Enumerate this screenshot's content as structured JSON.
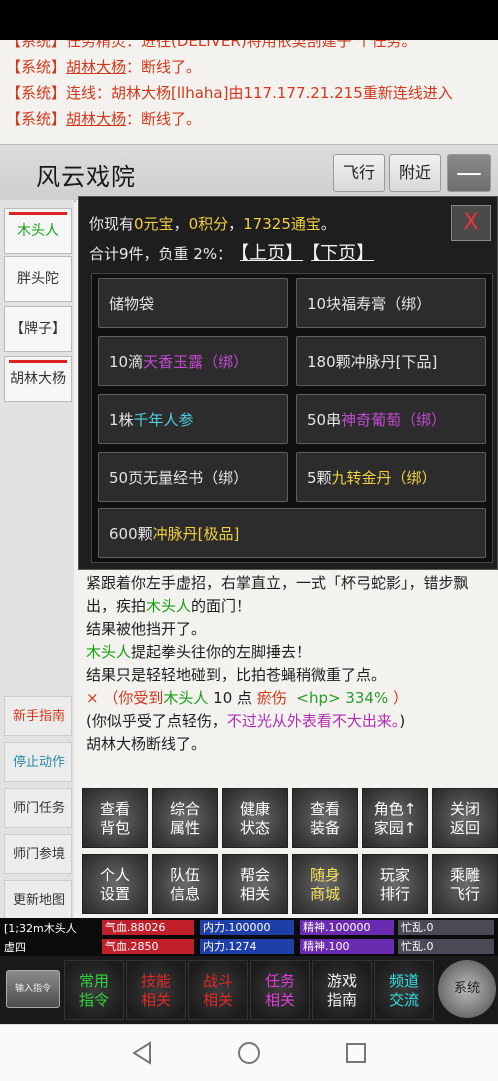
{
  "log": {
    "partial_line": "【系统】任务精灵：进往(DELIVER)将用依契剖建子    个任务。",
    "lines": [
      {
        "tag": "【系统】",
        "name": "胡林大杨",
        "text": "：断线了。",
        "underline": true
      },
      {
        "tag": "【系统】",
        "name": "",
        "text": "连线：胡林大杨[llhaha]由117.177.21.215重新连线进入",
        "underline": false
      },
      {
        "tag": "【系统】",
        "name": "胡林大杨",
        "text": "：断线了。",
        "underline": true
      }
    ]
  },
  "header": {
    "title": "风云戏院",
    "fly_label": "飞行",
    "nearby_label": "附近",
    "minimize_label": "—"
  },
  "npcs": [
    "木头人",
    "胖头陀",
    "【牌子】",
    "胡林大杨"
  ],
  "left_buttons": [
    "新手指南",
    "停止动作",
    "师门任务",
    "师门参境",
    "更新地图"
  ],
  "inventory": {
    "summary_prefix": "你现有",
    "yuanbao": "0元宝",
    "sep1": "，",
    "score": "0积分",
    "sep2": "，",
    "tongbao": "17325通宝",
    "summary_suffix": "。",
    "count_text": "合计9件，负重 2%：",
    "prev_page": "【上页】",
    "next_page": "【下页】",
    "close_label": "X",
    "items": [
      {
        "a": "储物袋",
        "b": "",
        "c": ""
      },
      {
        "a": "10块福寿膏（绑）",
        "b": "",
        "c": ""
      },
      {
        "a": "10滴",
        "b": "天香玉露（绑）",
        "c": "",
        "color": "p"
      },
      {
        "a": "180颗冲脉丹[下品]",
        "b": "",
        "c": ""
      },
      {
        "a": "1株",
        "b": "千年人参",
        "c": "",
        "color": "c"
      },
      {
        "a": "50串",
        "b": "神奇葡萄（绑）",
        "c": "",
        "color": "p"
      },
      {
        "a": "50页无量经书（绑）",
        "b": "",
        "c": ""
      },
      {
        "a": "5颗",
        "b": "九转金丹（绑）",
        "c": "",
        "color": "yl"
      },
      {
        "a": "600颗",
        "b": "冲脉丹[极品]",
        "c": "",
        "color": "yl"
      }
    ]
  },
  "story": {
    "l1": "紧跟着你左手虚招，右掌直立，一式「杯弓蛇影」，错步飘出，疾拍",
    "l1_name": "木头人",
    "l1_end": "的面门！",
    "l2": "结果被他挡开了。",
    "l3_name": "木头人",
    "l3": "提起拳头往你的左脚捶去！",
    "l4": "结果只是轻轻地碰到，比拍苍蝇稍微重了点。",
    "l5_mark": "×",
    "l5_a": "（你受到",
    "l5_name": "木头人",
    "l5_num": "10 点",
    "l5_type": "瘀伤",
    "l5_hp": "<hp> 334%",
    "l5_end": "）",
    "l6_a": "(你似乎受了点轻伤，",
    "l6_b": "不过光从外表看不大出来。",
    "l6_c": ")",
    "l7": "胡林大杨断线了。"
  },
  "commands_row1": [
    "查看\n背包",
    "综合\n属性",
    "健康\n状态",
    "查看\n装备",
    "角色↑\n家园↑",
    "关闭\n返回"
  ],
  "commands_row2": [
    "个人\n设置",
    "队伍\n信息",
    "帮会\n相关",
    "随身\n商城",
    "玩家\n排行",
    "乘雕\n飞行"
  ],
  "stats": {
    "row1": {
      "name": "[1;32m木头人",
      "qixue": "气血.88026",
      "neili": "内力.100000",
      "jingshen": "精神.100000",
      "mangluan": "忙乱.0"
    },
    "row2": {
      "name": "虚四",
      "qixue": "气血.2850",
      "neili": "内力.1274",
      "jingshen": "精神.100",
      "mangluan": "忙乱.0"
    }
  },
  "bottom": {
    "input_label": "输入指令",
    "buttons": [
      "常用\n指令",
      "技能\n相关",
      "战斗\n相关",
      "任务\n相关",
      "游戏\n指南",
      "频道\n交流"
    ],
    "round_label": "系统"
  },
  "colors": {
    "system_red": "#d2371c",
    "npc_green": "#19a019",
    "gold": "#f0d040",
    "purple": "#b02fb0"
  }
}
